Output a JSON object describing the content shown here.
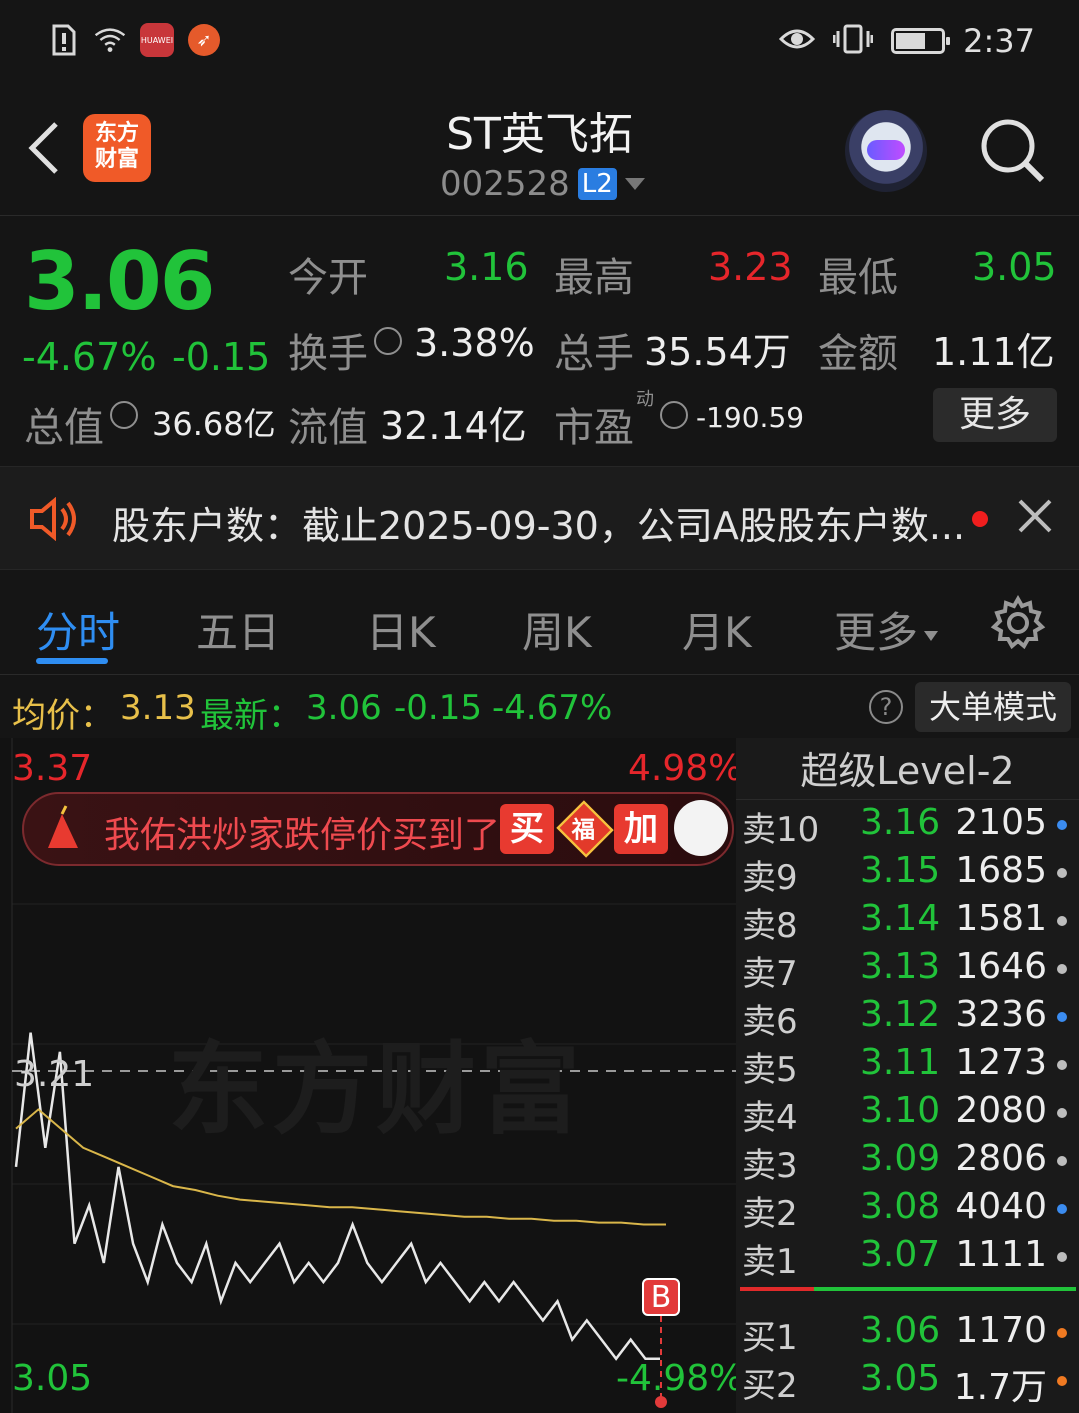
{
  "status_bar": {
    "time": "2:37",
    "app1": "HUAWEI"
  },
  "header": {
    "title": "ST英飞拓",
    "code": "002528",
    "level_badge": "L2",
    "logo_text_line1": "东方",
    "logo_text_line2": "财富"
  },
  "quote": {
    "price": "3.06",
    "change_pct": "-4.67%",
    "change_amt": "-0.15",
    "open_label": "今开",
    "open": "3.16",
    "high_label": "最高",
    "high": "3.23",
    "low_label": "最低",
    "low": "3.05",
    "turnover_label": "换手",
    "turnover": "3.38%",
    "volume_label": "总手",
    "volume": "35.54万",
    "amount_label": "金额",
    "amount": "1.11亿",
    "mktcap_label": "总值",
    "mktcap": "36.68亿",
    "float_label": "流值",
    "float_cap": "32.14亿",
    "pe_label": "市盈",
    "pe_sup": "动",
    "pe": "-190.59",
    "more_button": "更多"
  },
  "notice": {
    "text": "股东户数：截止2025-09-30，公司A股股东户数..."
  },
  "tabs": [
    {
      "label": "分时",
      "active": true
    },
    {
      "label": "五日"
    },
    {
      "label": "日K"
    },
    {
      "label": "周K"
    },
    {
      "label": "月K"
    },
    {
      "label": "更多"
    }
  ],
  "infoline": {
    "avg_label": "均价：",
    "avg": "3.13",
    "last_label": "最新：",
    "last": "3.06",
    "chg": "-0.15",
    "pct": "-4.67%",
    "help": "?",
    "big_order_button": "大单模式"
  },
  "chart": {
    "top_price": "3.37",
    "top_pct": "4.98%",
    "ref_price": "3.21",
    "bottom_price": "3.05",
    "bottom_pct": "-4.98%",
    "watermark": "东方财富",
    "promo_text": "我佑洪炒家跌停价买到了",
    "promo_btn1": "买",
    "promo_btn2": "福",
    "promo_btn3": "加",
    "marker": "B"
  },
  "chart_data": {
    "type": "line",
    "ylim": [
      3.05,
      3.37
    ],
    "series": [
      {
        "values": [
          3.16,
          3.23,
          3.17,
          3.22,
          3.12,
          3.14,
          3.11,
          3.16,
          3.12,
          3.1,
          3.13,
          3.11,
          3.1,
          3.12,
          3.09,
          3.11,
          3.1,
          3.11,
          3.12,
          3.1,
          3.11,
          3.1,
          3.11,
          3.13,
          3.11,
          3.1,
          3.11,
          3.12,
          3.1,
          3.11,
          3.1,
          3.09,
          3.1,
          3.09,
          3.1,
          3.09,
          3.08,
          3.09,
          3.07,
          3.08,
          3.07,
          3.06,
          3.07,
          3.06,
          3.06
        ]
      },
      {
        "values": [
          3.18,
          3.19,
          3.18,
          3.17,
          3.165,
          3.16,
          3.155,
          3.15,
          3.148,
          3.145,
          3.143,
          3.142,
          3.141,
          3.14,
          3.139,
          3.139,
          3.138,
          3.137,
          3.136,
          3.135,
          3.134,
          3.134,
          3.133,
          3.133,
          3.132,
          3.132,
          3.131,
          3.131,
          3.13,
          3.13
        ]
      }
    ]
  },
  "order_book": {
    "title": "超级Level-2",
    "asks": [
      {
        "label": "卖10",
        "price": "3.16",
        "vol": "2105",
        "dot": "#3b8cf0"
      },
      {
        "label": "卖9",
        "price": "3.15",
        "vol": "1685",
        "dot": "#bdbdbd"
      },
      {
        "label": "卖8",
        "price": "3.14",
        "vol": "1581",
        "dot": "#bdbdbd"
      },
      {
        "label": "卖7",
        "price": "3.13",
        "vol": "1646",
        "dot": "#bdbdbd"
      },
      {
        "label": "卖6",
        "price": "3.12",
        "vol": "3236",
        "dot": "#3b8cf0"
      },
      {
        "label": "卖5",
        "price": "3.11",
        "vol": "1273",
        "dot": "#bdbdbd"
      },
      {
        "label": "卖4",
        "price": "3.10",
        "vol": "2080",
        "dot": "#bdbdbd"
      },
      {
        "label": "卖3",
        "price": "3.09",
        "vol": "2806",
        "dot": "#bdbdbd"
      },
      {
        "label": "卖2",
        "price": "3.08",
        "vol": "4040",
        "dot": "#3b8cf0"
      },
      {
        "label": "卖1",
        "price": "3.07",
        "vol": "1111",
        "dot": "#bdbdbd"
      }
    ],
    "bids": [
      {
        "label": "买1",
        "price": "3.06",
        "vol": "1170",
        "dot": "#f07a22"
      },
      {
        "label": "买2",
        "price": "3.05",
        "vol": "1.7万",
        "dot": "#f07a22"
      }
    ]
  }
}
